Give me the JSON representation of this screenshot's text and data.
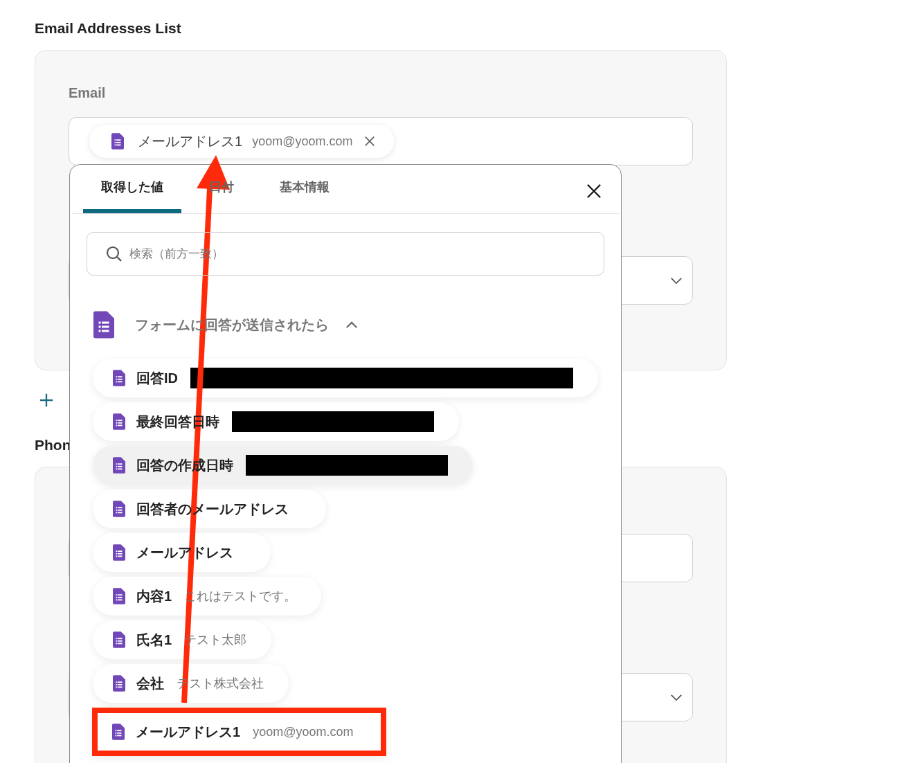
{
  "section_title": "Email Addresses List",
  "email_card": {
    "label": "Email",
    "chip": {
      "label": "メールアドレス1",
      "value": "yoom@yoom.com"
    }
  },
  "phone_title": "Phon",
  "popup": {
    "tabs": [
      {
        "label": "取得した値",
        "selected": true
      },
      {
        "label": "日付",
        "selected": false
      },
      {
        "label": "基本情報",
        "selected": false
      }
    ],
    "search": {
      "placeholder": "検索（前方一致）"
    },
    "group": {
      "title": "フォームに回答が送信されたら",
      "expanded": true
    },
    "items": [
      {
        "label": "回答ID",
        "redacted": true,
        "hovered": false,
        "highlighted": false
      },
      {
        "label": "最終回答日時",
        "redacted": true,
        "hovered": false,
        "highlighted": false
      },
      {
        "label": "回答の作成日時",
        "redacted": true,
        "hovered": true,
        "highlighted": false
      },
      {
        "label": "回答者のメールアドレス",
        "redacted": false,
        "hovered": false,
        "highlighted": false
      },
      {
        "label": "メールアドレス",
        "redacted": false,
        "hovered": false,
        "highlighted": false
      },
      {
        "label": "内容1",
        "value": "これはテストです。",
        "redacted": false,
        "hovered": false,
        "highlighted": false
      },
      {
        "label": "氏名1",
        "value": "テスト太郎",
        "redacted": false,
        "hovered": false,
        "highlighted": false
      },
      {
        "label": "会社",
        "value": "テスト株式会社",
        "redacted": false,
        "hovered": false,
        "highlighted": false
      },
      {
        "label": "メールアドレス1",
        "value": "yoom@yoom.com",
        "redacted": false,
        "hovered": false,
        "highlighted": true
      }
    ]
  }
}
